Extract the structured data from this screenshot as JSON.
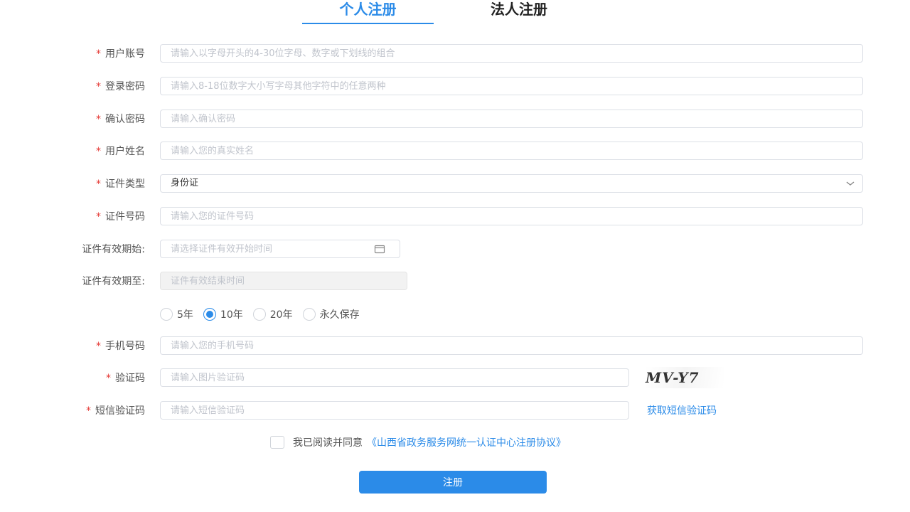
{
  "tabs": [
    {
      "label": "个人注册",
      "active": true
    },
    {
      "label": "法人注册",
      "active": false
    }
  ],
  "form": {
    "required_mark": "*",
    "account": {
      "label": "用户账号",
      "placeholder": "请输入以字母开头的4-30位字母、数字或下划线的组合"
    },
    "password": {
      "label": "登录密码",
      "placeholder": "请输入8-18位数字大小写字母其他字符中的任意两种"
    },
    "confirm_password": {
      "label": "确认密码",
      "placeholder": "请输入确认密码"
    },
    "real_name": {
      "label": "用户姓名",
      "placeholder": "请输入您的真实姓名"
    },
    "id_type": {
      "label": "证件类型",
      "value": "身份证"
    },
    "id_number": {
      "label": "证件号码",
      "placeholder": "请输入您的证件号码"
    },
    "valid_from": {
      "label": "证件有效期始:",
      "placeholder": "请选择证件有效开始时间"
    },
    "valid_to": {
      "label": "证件有效期至:",
      "placeholder": "证件有效结束时间"
    },
    "validity_options": [
      {
        "label": "5年",
        "checked": false
      },
      {
        "label": "10年",
        "checked": true
      },
      {
        "label": "20年",
        "checked": false
      },
      {
        "label": "永久保存",
        "checked": false
      }
    ],
    "phone": {
      "label": "手机号码",
      "placeholder": "请输入您的手机号码"
    },
    "captcha": {
      "label": "验证码",
      "placeholder": "请输入图片验证码",
      "image_text": "MV-Y7"
    },
    "sms_code": {
      "label": "短信验证码",
      "placeholder": "请输入短信验证码",
      "get_link": "获取短信验证码"
    },
    "agreement": {
      "text": "我已阅读并同意",
      "link": "《山西省政务服务网统一认证中心注册协议》"
    },
    "submit_label": "注册"
  },
  "colors": {
    "accent": "#2b8be8",
    "required": "#e53935"
  }
}
